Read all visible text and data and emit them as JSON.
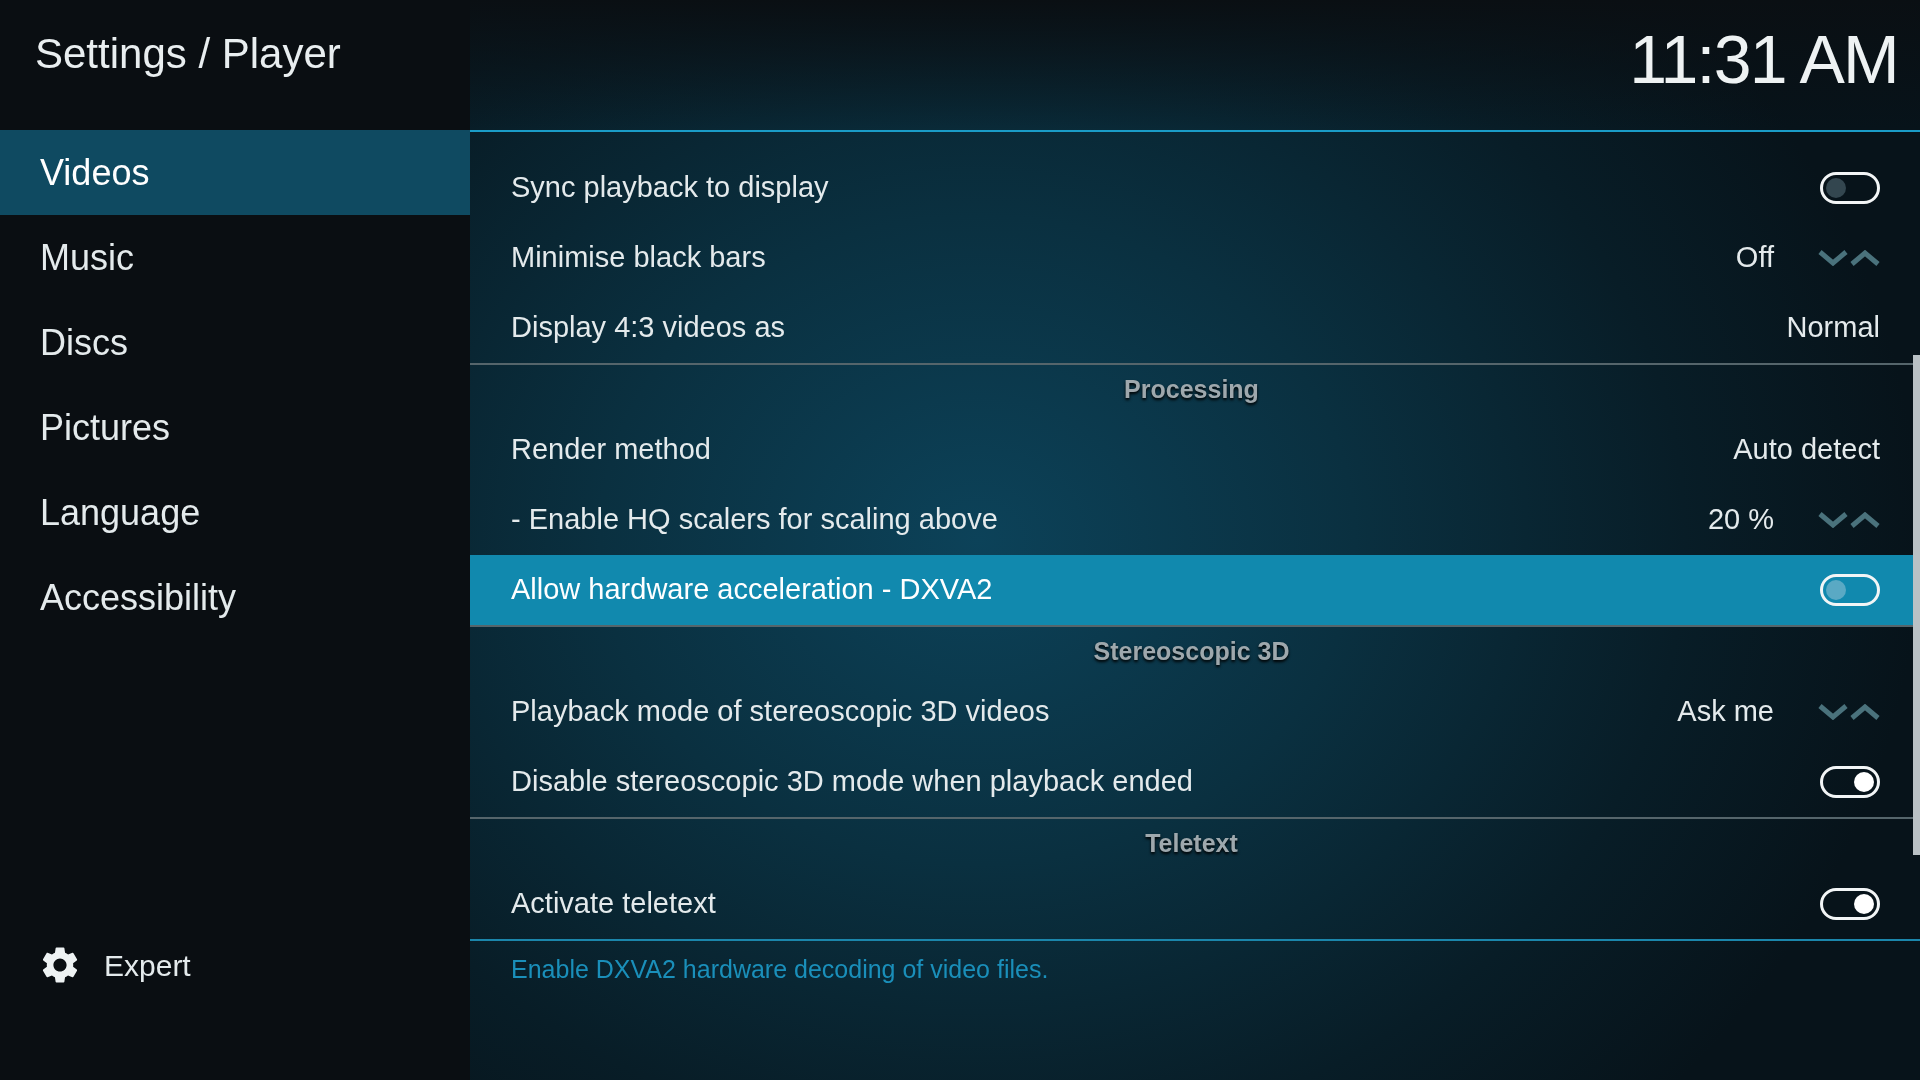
{
  "header": {
    "title": "Settings / Player",
    "clock": "11:31 AM"
  },
  "sidebar": {
    "items": [
      {
        "label": "Videos",
        "selected": true
      },
      {
        "label": "Music",
        "selected": false
      },
      {
        "label": "Discs",
        "selected": false
      },
      {
        "label": "Pictures",
        "selected": false
      },
      {
        "label": "Language",
        "selected": false
      },
      {
        "label": "Accessibility",
        "selected": false
      }
    ],
    "settings_level": {
      "label": "Expert"
    }
  },
  "settings": {
    "sections": [
      {
        "rows": [
          {
            "kind": "toggle",
            "label": "Sync playback to display",
            "on": false,
            "selected": false
          },
          {
            "kind": "spinner",
            "label": "Minimise black bars",
            "value": "Off",
            "selected": false
          },
          {
            "kind": "value",
            "label": "Display 4:3 videos as",
            "value": "Normal",
            "selected": false
          }
        ]
      },
      {
        "title": "Processing",
        "rows": [
          {
            "kind": "value",
            "label": "Render method",
            "value": "Auto detect",
            "selected": false
          },
          {
            "kind": "spinner",
            "label": "- Enable HQ scalers for scaling above",
            "value": "20 %",
            "selected": false
          },
          {
            "kind": "toggle",
            "label": "Allow hardware acceleration - DXVA2",
            "on": false,
            "selected": true
          }
        ]
      },
      {
        "title": "Stereoscopic 3D",
        "rows": [
          {
            "kind": "spinner",
            "label": "Playback mode of stereoscopic 3D videos",
            "value": "Ask me",
            "selected": false
          },
          {
            "kind": "toggle",
            "label": "Disable stereoscopic 3D mode when playback ended",
            "on": true,
            "selected": false
          }
        ]
      },
      {
        "title": "Teletext",
        "rows": [
          {
            "kind": "toggle",
            "label": "Activate teletext",
            "on": true,
            "selected": false
          }
        ]
      }
    ],
    "description": "Enable DXVA2 hardware decoding of video files."
  }
}
